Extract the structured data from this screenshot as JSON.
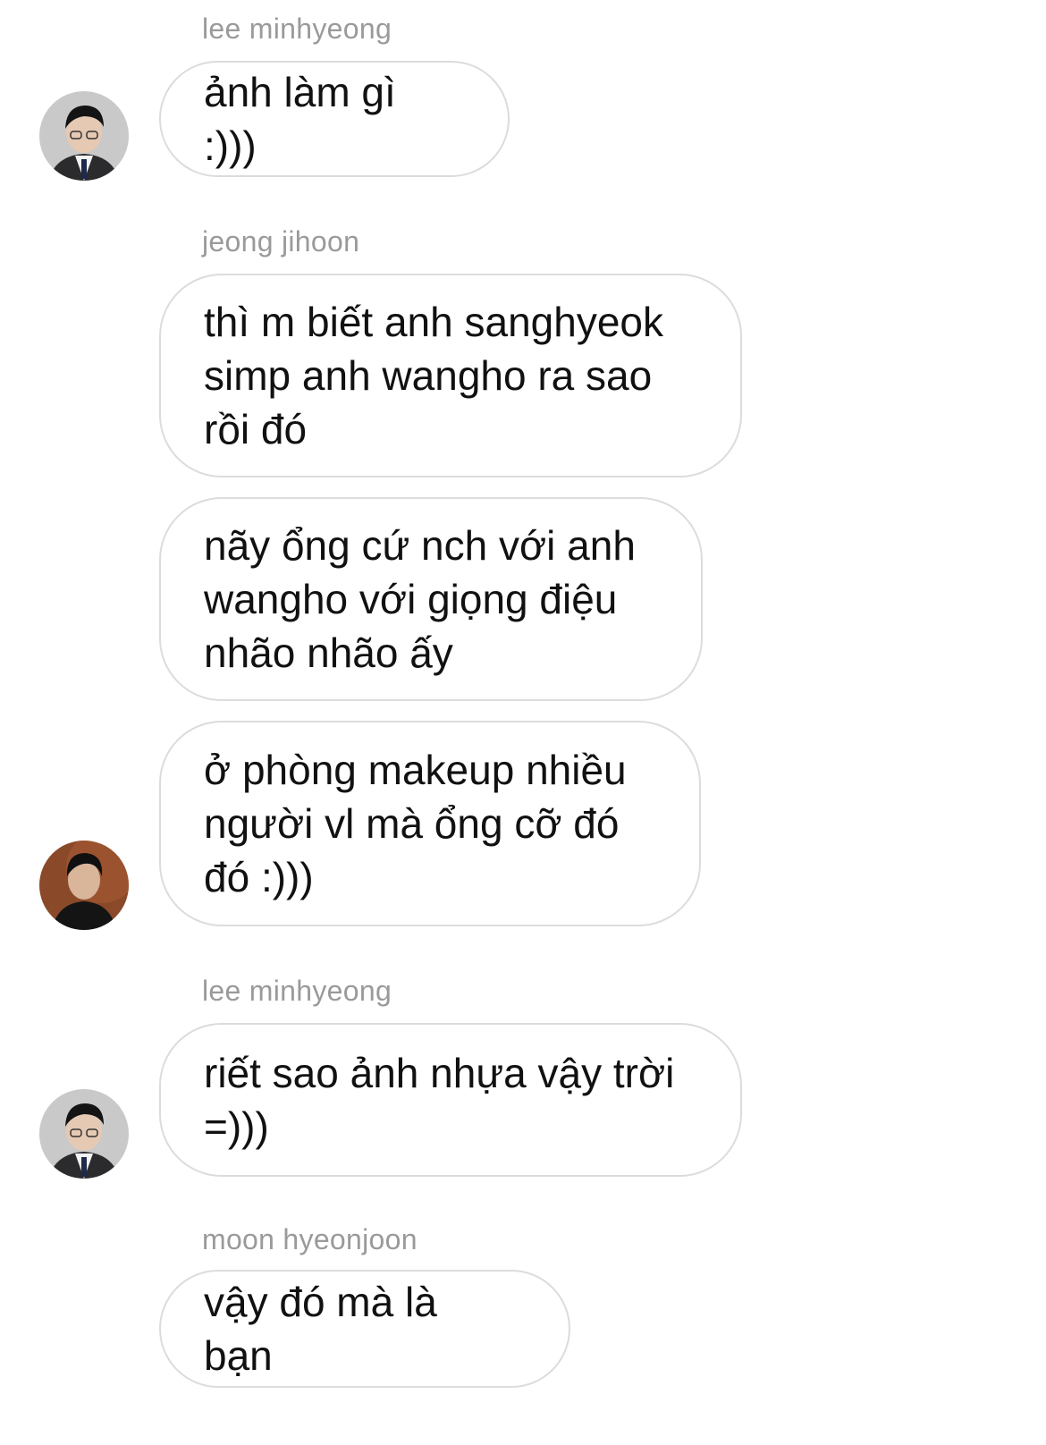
{
  "messages": [
    {
      "sender": "lee minhyeong",
      "text": "ảnh làm gì :)))"
    },
    {
      "sender": "jeong jihoon",
      "text": "thì m biết anh sanghyeok simp anh wangho ra sao rồi đó"
    },
    {
      "text": "nãy ổng cứ nch với anh wangho với giọng điệu nhão nhão ấy"
    },
    {
      "text": "ở phòng makeup nhiều người vl mà ổng cỡ đó đó :)))"
    },
    {
      "sender": "lee minhyeong",
      "text": "riết sao ảnh nhựa vậy trời =)))"
    },
    {
      "sender": "moon hyeonjoon",
      "text": "vậy đó mà là bạn"
    }
  ],
  "colors": {
    "bubble_border": "#dcdcdc",
    "sender_name": "#9a9a9a",
    "message_text": "#111111",
    "background": "#ffffff"
  }
}
